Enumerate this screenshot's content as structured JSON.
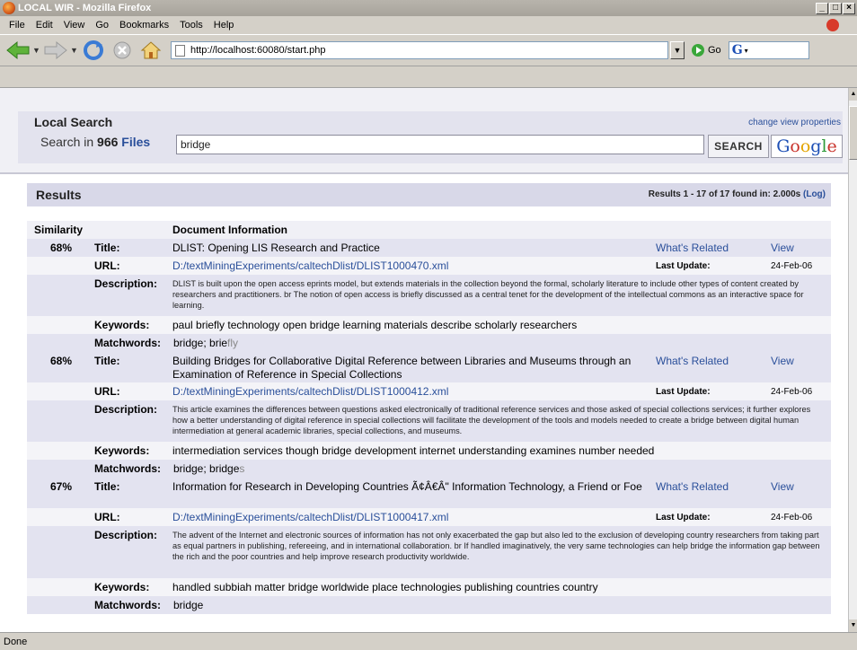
{
  "window": {
    "title": "LOCAL WIR - Mozilla Firefox",
    "buttons": [
      "_",
      "□",
      "×"
    ]
  },
  "menu": [
    {
      "label": "File"
    },
    {
      "label": "Edit"
    },
    {
      "label": "View"
    },
    {
      "label": "Go"
    },
    {
      "label": "Bookmarks"
    },
    {
      "label": "Tools"
    },
    {
      "label": "Help"
    }
  ],
  "navbar": {
    "url": "http://localhost:60080/start.php",
    "go_label": "Go",
    "search_engine_letter": "G"
  },
  "search": {
    "heading": "Local Search",
    "change_view": "change view properties",
    "search_in_prefix": "Search in",
    "file_count": "966",
    "files_label": "Files",
    "query": "bridge",
    "search_button": "SEARCH",
    "google_button": "Google"
  },
  "results": {
    "heading": "Results",
    "summary": "Results 1 - 17 of 17 found in: 2.000s",
    "log_label": "(Log)",
    "col_similarity": "Similarity",
    "col_doc_info": "Document Information",
    "labels": {
      "title": "Title:",
      "url": "URL:",
      "description": "Description:",
      "keywords": "Keywords:",
      "matchwords": "Matchwords:",
      "last_update": "Last Update:",
      "whats_related": "What's Related",
      "view": "View"
    },
    "items": [
      {
        "similarity": "68%",
        "title": "DLIST: Opening LIS Research and Practice",
        "url": "D:/textMiningExperiments/caltechDlist/DLIST1000470.xml",
        "last_update": "24-Feb-06",
        "description": "DLIST is built upon the open access eprints model, but extends materials in the collection beyond the formal, scholarly literature to include other types of content created by researchers and practitioners. br The notion of open access is briefly discussed as a central tenet for the development of the intellectual commons as an interactive space for learning.",
        "keywords": "paul briefly technology open bridge learning materials describe scholarly researchers",
        "matchwords": "bridge; brie",
        "matchwords_grey": "fly"
      },
      {
        "similarity": "68%",
        "title": "Building Bridges for Collaborative Digital Reference between Libraries and Museums through an Examination of Reference in Special Collections",
        "url": "D:/textMiningExperiments/caltechDlist/DLIST1000412.xml",
        "last_update": "24-Feb-06",
        "description": "This article examines the differences between questions asked electronically of traditional reference services and those asked of special collections services; it further explores how a better understanding of digital reference in special collections will facilitate the development of the tools and models needed to create a bridge between digital human intermediation at general academic libraries, special collections, and museums.",
        "keywords": "intermediation services though bridge development internet understanding examines number needed",
        "matchwords": "bridge; bridge",
        "matchwords_grey": "s"
      },
      {
        "similarity": "67%",
        "title": "Information for Research in Developing Countries Ã¢Â€Â\" Information Technology, a Friend or Foe",
        "url": "D:/textMiningExperiments/caltechDlist/DLIST1000417.xml",
        "last_update": "24-Feb-06",
        "description": "The advent of the Internet and electronic sources of information has not only exacerbated the gap but also led to the exclusion of developing country researchers from taking part as equal partners in publishing, refereeing, and in international collaboration. br If handled imaginatively, the very same technologies can help bridge the information gap between the rich and the poor countries and help improve research productivity worldwide.",
        "keywords": "handled subbiah matter bridge worldwide place technologies publishing countries country",
        "matchwords": "bridge",
        "matchwords_grey": ""
      }
    ]
  },
  "status": "Done"
}
